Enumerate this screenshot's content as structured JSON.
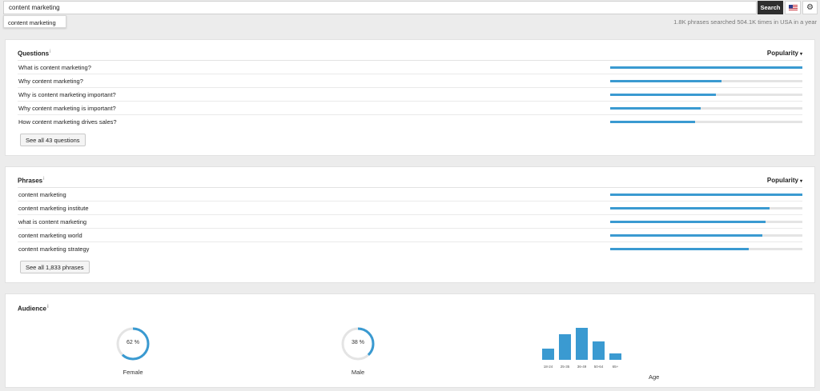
{
  "search": {
    "query": "content marketing",
    "button_label": "Search",
    "suggestion": "content marketing",
    "stats": "1.8K phrases searched 504.1K times in USA in a year"
  },
  "questions": {
    "title": "Questions",
    "info": "i",
    "sort_label": "Popularity",
    "sort_caret": "▾",
    "see_all_label": "See all 43 questions",
    "rows": [
      {
        "label": "What is content marketing?",
        "popularity": 1.0
      },
      {
        "label": "Why content marketing?",
        "popularity": 0.58
      },
      {
        "label": "Why is content marketing important?",
        "popularity": 0.55
      },
      {
        "label": "Why content marketing is important?",
        "popularity": 0.47
      },
      {
        "label": "How content marketing drives sales?",
        "popularity": 0.44
      }
    ]
  },
  "phrases": {
    "title": "Phrases",
    "info": "i",
    "sort_label": "Popularity",
    "sort_caret": "▾",
    "see_all_label": "See all 1,833 phrases",
    "rows": [
      {
        "label": "content marketing",
        "popularity": 1.0
      },
      {
        "label": "content marketing institute",
        "popularity": 0.83
      },
      {
        "label": "what is content marketing",
        "popularity": 0.81
      },
      {
        "label": "content marketing world",
        "popularity": 0.79
      },
      {
        "label": "content marketing strategy",
        "popularity": 0.72
      }
    ]
  },
  "audience": {
    "title": "Audience",
    "info": "i",
    "female": {
      "percent": 62,
      "label": "62 %",
      "caption": "Female"
    },
    "male": {
      "percent": 38,
      "label": "38 %",
      "caption": "Male"
    },
    "age_caption": "Age"
  },
  "chart_data": {
    "type": "bar",
    "categories": [
      "18-24",
      "25-35",
      "36-49",
      "50-64",
      "65+"
    ],
    "values": [
      14,
      32,
      40,
      23,
      8
    ],
    "xlabel": "Age",
    "ylabel": "",
    "ylim": [
      0,
      40
    ]
  },
  "colors": {
    "accent": "#3a9ad1",
    "track": "#e4e4e4",
    "search_button": "#2e2e2e"
  },
  "icons": {
    "flag": "us-flag-icon",
    "settings": "gear-icon",
    "info": "info-icon",
    "sort": "chevron-down-icon"
  }
}
